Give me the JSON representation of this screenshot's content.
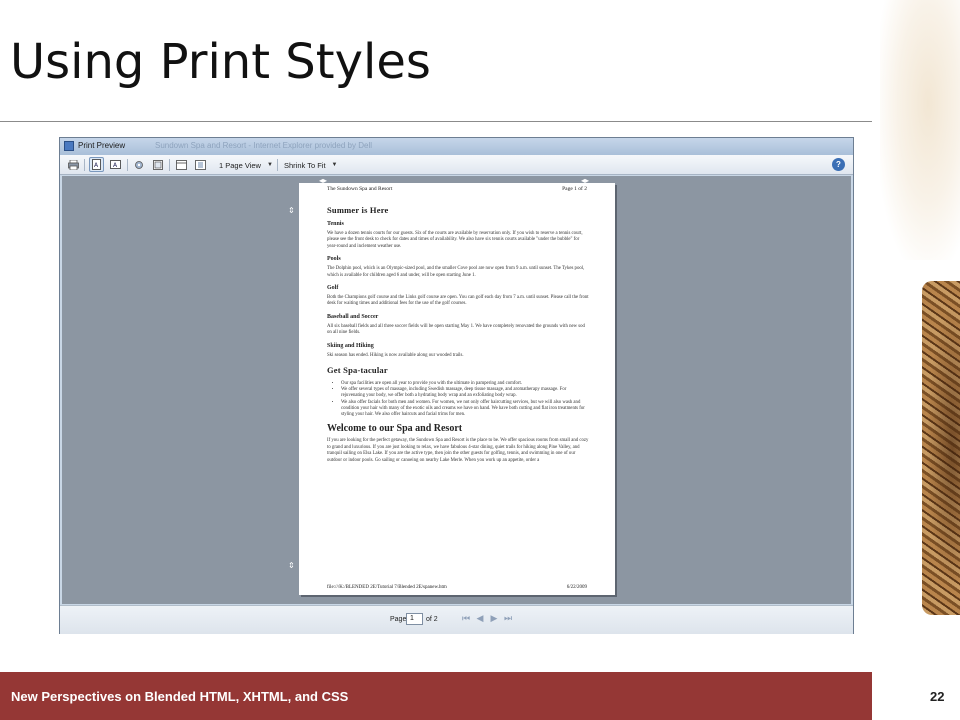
{
  "slide": {
    "title": "Using Print Styles",
    "footer": "New Perspectives on Blended HTML, XHTML, and CSS",
    "page_number": "22"
  },
  "window": {
    "title": "Print Preview",
    "title_ghost": "Sundown Spa and Resort - Internet Explorer provided by Dell",
    "toolbar": {
      "view_select": "1 Page View",
      "shrink_select": "Shrink To Fit",
      "help": "?"
    },
    "status": {
      "page_label": "Page",
      "page_value": "1",
      "page_of": "of 2"
    }
  },
  "document": {
    "header_left": "The Sundown Spa and Resort",
    "header_right": "Page 1 of 2",
    "footer_left": "file:///K:/BLENDED 2E/Tutorial 7/Blended 2E/spanew.htm",
    "footer_right": "6/22/2009",
    "h_summer": "Summer is Here",
    "h_tennis": "Tennis",
    "p_tennis": "We have a dozen tennis courts for our guests. Six of the courts are available by reservation only. If you wish to reserve a tennis court, please see the front desk to check for dates and times of availability. We also have six tennis courts available \"under the bubble\" for year-round and inclement weather use.",
    "h_pools": "Pools",
    "p_pools": "The Dolphin pool, which is an Olympic-sized pool, and the smaller Cove pool are now open from 9 a.m. until sunset. The Tykes pool, which is available for children aged 6 and under, will be open starting June 1.",
    "h_golf": "Golf",
    "p_golf": "Both the Champions golf course and the Links golf course are open. You can golf each day from 7 a.m. until sunset. Please call the front desk for waiting times and additional fees for the use of the golf courses.",
    "h_baseball": "Baseball and Soccer",
    "p_baseball": "All six baseball fields and all three soccer fields will be open starting May 1. We have completely renovated the grounds with new sod on all nine fields.",
    "h_skiing": "Skiing and Hiking",
    "p_skiing": "Ski season has ended. Hiking is now available along our wooded trails.",
    "h_spa": "Get Spa-tacular",
    "spa_bullets": [
      "Our spa facilities are open all year to provide you with the ultimate in pampering and comfort.",
      "We offer several types of massage, including Swedish massage, deep tissue massage, and aromatherapy massage. For rejuvenating your body, we offer both a hydrating body wrap and an exfoliating body wrap.",
      "We also offer facials for both men and women. For women, we not only offer haircutting services, but we will also wash and condition your hair with many of the exotic oils and creams we have on hand. We have both cutting and flat iron treatments for styling your hair. We also offer haircuts and facial trims for men."
    ],
    "h_welcome": "Welcome to our Spa and Resort",
    "p_welcome": "If you are looking for the perfect getaway, the Sundown Spa and Resort is the place to be. We offer spacious rooms from small and cozy to grand and luxurious. If you are just looking to relax, we have fabulous 4-star dining, quiet trails for hiking along Pine Valley, and tranquil sailing on Elsa Lake. If you are the active type, then join the other guests for golfing, tennis, and swimming in one of our outdoor or indoor pools. Go sailing or canoeing on nearby Lake Merle. When you work up an appetite, order a"
  }
}
